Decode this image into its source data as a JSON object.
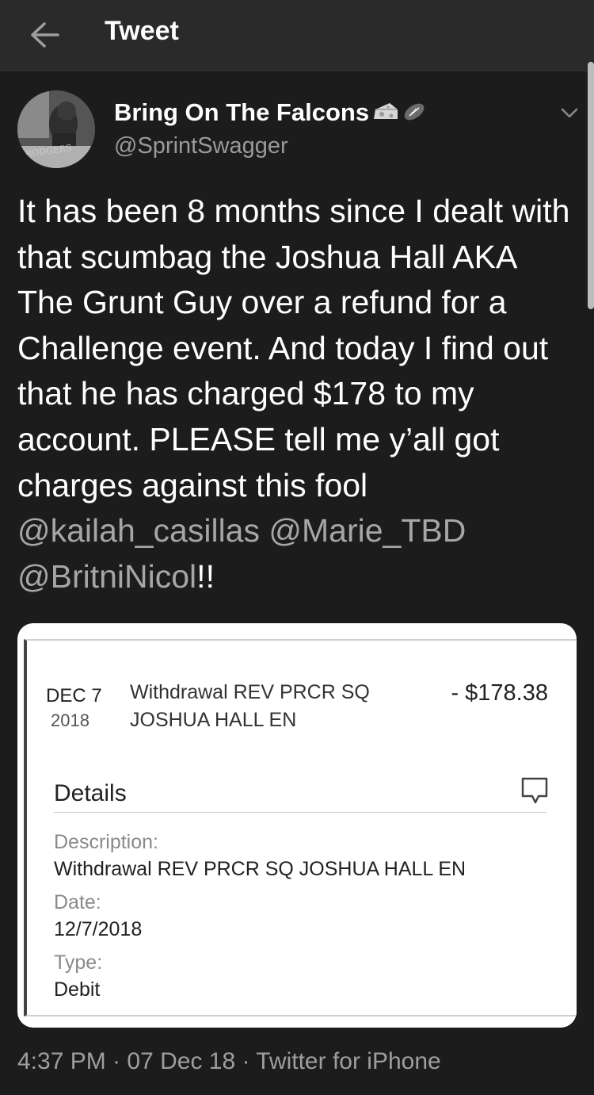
{
  "header": {
    "title": "Tweet",
    "back_icon": "back-arrow-icon"
  },
  "author": {
    "display_name": "Bring On The Falcons",
    "handle": "@SprintSwagger",
    "avatar_caption": "RODGERS",
    "name_emojis": [
      "cheese-icon",
      "football-icon"
    ]
  },
  "tweet": {
    "text": "It has been 8 months since I dealt with that scumbag the Joshua Hall AKA The Grunt Guy over a refund for a Challenge event. And today I find out that he has charged $178 to my account. PLEASE tell me y’all got charges against this fool ",
    "mentions": [
      "@kailah_casillas",
      "@Marie_TBD",
      "@BritniNicol"
    ],
    "suffix": "!!",
    "timestamp": "4:37 PM · 07 Dec 18 · Twitter for iPhone"
  },
  "bank_card": {
    "date_month": "DEC 7",
    "date_year": "2018",
    "txn_line1": "Withdrawal REV PRCR SQ",
    "txn_line2": "JOSHUA HALL EN",
    "amount": "- $178.38",
    "details_title": "Details",
    "fields": [
      {
        "label": "Description:",
        "value": "Withdrawal REV PRCR SQ JOSHUA HALL EN"
      },
      {
        "label": "Date:",
        "value": "12/7/2018"
      },
      {
        "label": "Type:",
        "value": "Debit"
      }
    ]
  },
  "colors": {
    "background": "#1c1c1c",
    "header_bg": "#2a2a2a",
    "mention": "#a6a6a6",
    "secondary_text": "#9a9a9a"
  }
}
